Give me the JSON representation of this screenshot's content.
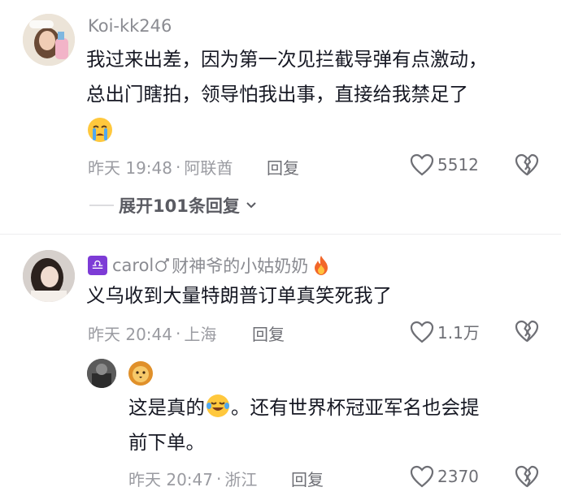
{
  "comments": [
    {
      "username": "Koi-kk246",
      "text_line1": "我过来出差，因为第一次见拦截导弹有点激动，",
      "text_line2": "总出门瞎拍，领导怕我出事，直接给我禁足了",
      "emoji": "crying-face",
      "time": "昨天 19:48",
      "location": "阿联酋",
      "reply_label": "回复",
      "likes": "5512",
      "expand_label": "展开101条回复"
    },
    {
      "username_prefix": "carol",
      "username_suffix": "财神爷的小姑奶奶",
      "badge_symbol": "♎",
      "text_line1": "义乌收到大量特朗普订单真笑死我了",
      "time": "昨天 20:44",
      "location": "上海",
      "reply_label": "回复",
      "likes": "1.1万"
    }
  ],
  "reply": {
    "name_emoji": "lion-face",
    "text_before_emoji": "这是真的",
    "text_after_emoji": "。还有世界杯冠亚军名也会提",
    "text_line2": "前下单。",
    "time": "昨天 20:47",
    "location": "浙江",
    "reply_label": "回复",
    "likes": "2370"
  },
  "colors": {
    "text_primary": "#161823",
    "text_secondary": "#9a9ba1",
    "badge_purple": "#7d3bd6",
    "fire_orange": "#f2672a"
  }
}
